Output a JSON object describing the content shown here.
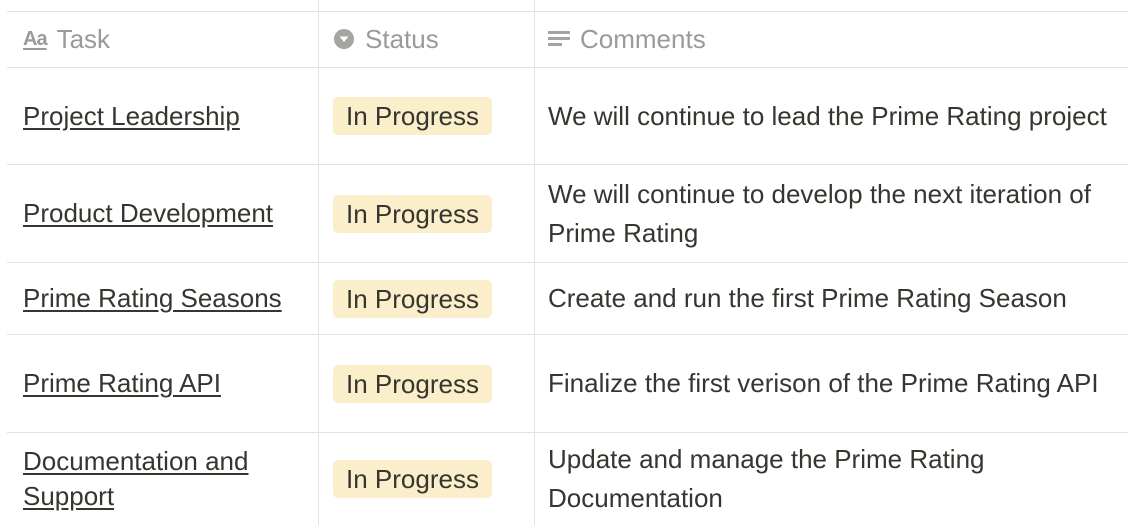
{
  "columns": {
    "task": {
      "label": "Task",
      "icon": "text-property-icon"
    },
    "status": {
      "label": "Status",
      "icon": "status-dropdown-icon"
    },
    "comments": {
      "label": "Comments",
      "icon": "text-lines-icon"
    }
  },
  "rows": [
    {
      "task": "Project Leadership",
      "status": "In Progress",
      "comment": "We will continue to lead the Prime Rating project"
    },
    {
      "task": "Product Development",
      "status": "In Progress",
      "comment": "We will continue to develop the next iteration of Prime Rating"
    },
    {
      "task": "Prime Rating Seasons",
      "status": "In Progress",
      "comment": "Create and run the first Prime Rating Season"
    },
    {
      "task": "Prime Rating API",
      "status": "In Progress",
      "comment": "Finalize the first verison of the Prime Rating API"
    },
    {
      "task": "Documentation and Support",
      "status": "In Progress",
      "comment": "Update and manage the Prime Rating Documentation"
    }
  ],
  "colors": {
    "status_badge_bg": "#fbeecb",
    "grid_line": "#e3e2e0",
    "header_text": "#9b9a97",
    "body_text": "#37352f"
  }
}
